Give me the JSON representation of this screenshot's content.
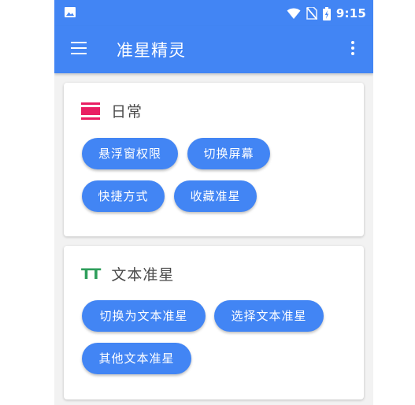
{
  "status_bar": {
    "time": "9:15",
    "icons": [
      "image-icon",
      "wifi-icon",
      "no-sim-icon",
      "battery-icon"
    ]
  },
  "app_bar": {
    "title": "准星精灵",
    "menu_icon": "menu-icon",
    "more_icon": "more-vert-icon"
  },
  "colors": {
    "primary": "#4285f4",
    "daily_icon": "#e91e63",
    "text_icon": "#2e9e5b",
    "background": "#f2f2f2"
  },
  "sections": {
    "daily": {
      "title": "日常",
      "icon": "view-day-icon",
      "buttons": [
        "悬浮窗权限",
        "切换屏幕",
        "快捷方式",
        "收藏准星"
      ]
    },
    "text_crosshair": {
      "title": "文本准星",
      "icon": "text-fields-icon",
      "icon_text": "TT",
      "buttons": [
        "切换为文本准星",
        "选择文本准星",
        "其他文本准星"
      ]
    }
  }
}
